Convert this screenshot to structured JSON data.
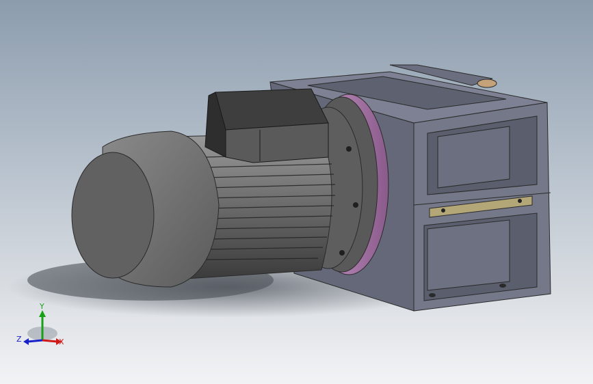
{
  "viewport": {
    "background_top": "#8c9cad",
    "background_bottom": "#f2f3f5"
  },
  "model": {
    "motor_color": "#6f6f6f",
    "housing_color": "#6e7282",
    "flange_ring_color": "#b07ab0",
    "plate_color": "#b3a778"
  },
  "triad": {
    "x_label": "X",
    "y_label": "Y",
    "z_label": "Z",
    "x_color": "#d01818",
    "y_color": "#18a018",
    "z_color": "#1820c8"
  }
}
